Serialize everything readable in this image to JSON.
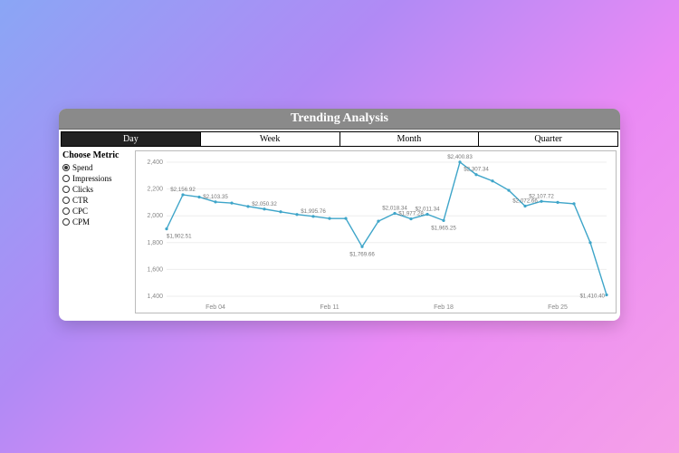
{
  "title": "Trending Analysis",
  "tabs": {
    "items": [
      "Day",
      "Week",
      "Month",
      "Quarter"
    ],
    "active": "Day"
  },
  "sidebar": {
    "heading": "Choose Metric",
    "metrics": [
      "Spend",
      "Impressions",
      "Clicks",
      "CTR",
      "CPC",
      "CPM"
    ],
    "selected": "Spend"
  },
  "chart_data": {
    "type": "line",
    "xlabel": "",
    "ylabel": "",
    "ylim": [
      1400,
      2400
    ],
    "yticks": [
      1400,
      1600,
      1800,
      2000,
      2200,
      2400
    ],
    "x_ticks": [
      "Feb 04",
      "Feb 11",
      "Feb 18",
      "Feb 25"
    ],
    "x_tick_indices": [
      3,
      10,
      17,
      24
    ],
    "x": [
      "Feb 01",
      "Feb 02",
      "Feb 03",
      "Feb 04",
      "Feb 05",
      "Feb 06",
      "Feb 07",
      "Feb 08",
      "Feb 09",
      "Feb 10",
      "Feb 11",
      "Feb 12",
      "Feb 13",
      "Feb 14",
      "Feb 15",
      "Feb 16",
      "Feb 17",
      "Feb 18",
      "Feb 19",
      "Feb 20",
      "Feb 21",
      "Feb 22",
      "Feb 23",
      "Feb 24",
      "Feb 25",
      "Feb 26",
      "Feb 27",
      "Feb 28"
    ],
    "values": [
      1902.51,
      2156.92,
      2140,
      2103.35,
      2095,
      2070,
      2050.32,
      2030,
      2010,
      1995.76,
      1980,
      1980,
      1769.66,
      1960,
      2018.34,
      1977.28,
      2011.34,
      1965.25,
      2400.83,
      2307.34,
      2260,
      2190,
      2072.66,
      2107.72,
      2100,
      2090,
      1800,
      1410.4
    ],
    "data_labels": [
      {
        "i": 0,
        "text": "$1,902.51"
      },
      {
        "i": 1,
        "text": "$2,156.92"
      },
      {
        "i": 3,
        "text": "$2,103.35"
      },
      {
        "i": 6,
        "text": "$2,050.32"
      },
      {
        "i": 9,
        "text": "$1,995.76"
      },
      {
        "i": 12,
        "text": "$1,769.66"
      },
      {
        "i": 14,
        "text": "$2,018.34"
      },
      {
        "i": 15,
        "text": "$1,977.28"
      },
      {
        "i": 16,
        "text": "$2,011.34"
      },
      {
        "i": 17,
        "text": "$1,965.25"
      },
      {
        "i": 18,
        "text": "$2,400.83"
      },
      {
        "i": 19,
        "text": "$2,307.34"
      },
      {
        "i": 22,
        "text": "$2,072.66"
      },
      {
        "i": 23,
        "text": "$2,107.72"
      },
      {
        "i": 27,
        "text": "$1,410.40"
      }
    ],
    "colors": {
      "line": "#3ea5c9"
    }
  }
}
